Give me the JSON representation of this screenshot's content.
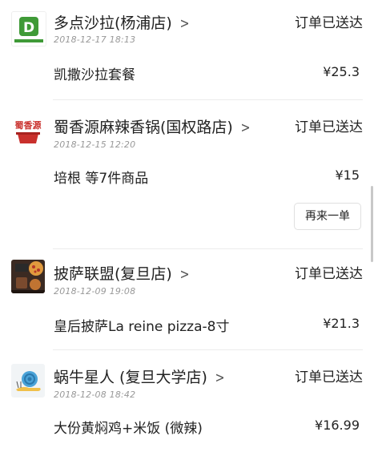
{
  "colors": {
    "logo_green": "#3f9a37",
    "logo_red": "#c9302c",
    "divider": "#ececec",
    "muted_text": "#999999"
  },
  "orders": [
    {
      "shop": "多点沙拉(杨浦店)",
      "status": "订单已送达",
      "time": "2018-12-17 18:13",
      "item": "凯撒沙拉套餐",
      "price": "¥25.3",
      "logo_icon": "salad-shop-logo-icon",
      "logo_letter": "D"
    },
    {
      "shop": "蜀香源麻辣香锅(国权路店)",
      "status": "订单已送达",
      "time": "2018-12-15 12:20",
      "item": "培根 等7件商品",
      "price": "¥15",
      "reorder": "再来一单",
      "logo_icon": "hotpot-shop-logo-icon",
      "logo_text": "蜀香源"
    },
    {
      "shop": "披萨联盟(复旦店)",
      "status": "订单已送达",
      "time": "2018-12-09 19:08",
      "item": "皇后披萨La reine pizza-8寸",
      "price": "¥21.3",
      "logo_icon": "pizza-shop-logo-icon"
    },
    {
      "shop": "蜗牛星人 (复旦大学店)",
      "status": "订单已送达",
      "time": "2018-12-08 18:42",
      "item": "大份黄焖鸡+米饭 (微辣)",
      "price": "¥16.99",
      "logo_icon": "snail-shop-logo-icon"
    }
  ]
}
